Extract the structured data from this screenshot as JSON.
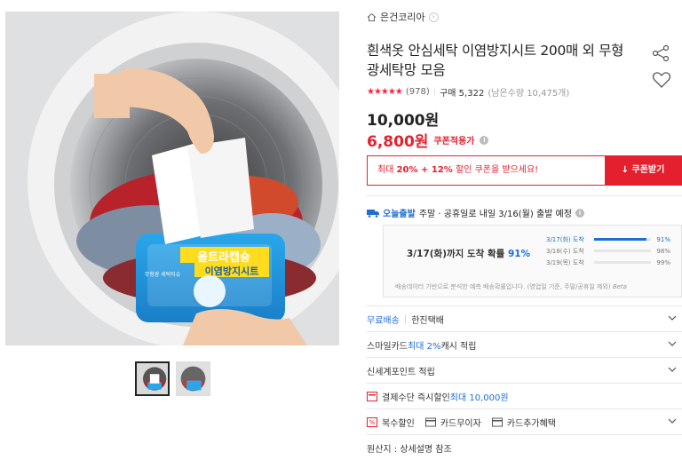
{
  "brand": {
    "name": "은건코리아"
  },
  "product": {
    "title": "흰색옷 안심세탁 이염방지시트 200매 외 무형광세탁망 모음",
    "rating_stars": "★★★★★",
    "review_count": "(978)",
    "sold": "구매 5,322",
    "stock": "(남은수량 10,475개)",
    "original_price": "10,000원",
    "sale_price": "6,800원",
    "coupon_applied": "쿠폰적용가"
  },
  "image_text": {
    "package_title_1": "울트라캡숑",
    "package_title_2": "이염방지시트",
    "package_side": "무형광 세탁티슈"
  },
  "coupon": {
    "message_prefix": "최대 ",
    "message_strong": "20% + 12%",
    "message_suffix": " 할인 쿠폰을 받으세요!",
    "button": "↓ 쿠폰받기"
  },
  "shipping": {
    "today_label": "오늘출발",
    "message": "주말 · 공휴일로 내일 3/16(월) 출발 예정",
    "arrival_prefix": "3/17(화)까지 도착 확률 ",
    "arrival_pct": "91%",
    "probabilities": [
      {
        "label": "3/17(화) 도착",
        "value": "91%",
        "fill": 0.91
      },
      {
        "label": "3/18(수) 도착",
        "value": "98%",
        "fill": 0.0
      },
      {
        "label": "3/19(목) 도착",
        "value": "99%",
        "fill": 0.0
      }
    ],
    "note": "배송데이터 기반으로 분석한 예측 배송확률입니다. (영업일 기준, 주말/공휴일 제외)",
    "note_brand": "Beta"
  },
  "options": {
    "delivery_free": "무료배송",
    "delivery_company": "한진택배",
    "smilecard_label": "스마일카드 ",
    "smilecard_strong": "최대 2%",
    "smilecard_suffix": " 캐시 적립",
    "shinsegae": "신세계포인트 적립",
    "instant_discount": "결제수단 즉시할인 ",
    "instant_discount_strong": "최대 10,000원",
    "multi_discount": "복수할인",
    "card_installment": "카드무이자",
    "card_benefit": "카드추가혜택",
    "origin": "원산지 : 상세설명 참조"
  },
  "colors": {
    "accent_red": "#e5202e",
    "accent_blue": "#1f6ed4"
  }
}
